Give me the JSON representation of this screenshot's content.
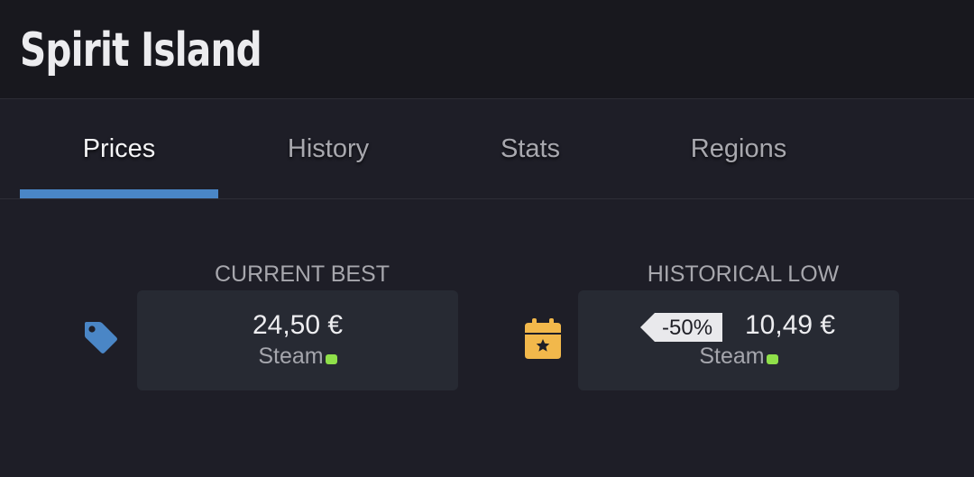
{
  "header": {
    "title": "Spirit Island"
  },
  "tabs": [
    {
      "label": "Prices",
      "active": true
    },
    {
      "label": "History",
      "active": false
    },
    {
      "label": "Stats",
      "active": false
    },
    {
      "label": "Regions",
      "active": false
    }
  ],
  "current_best": {
    "label": "CURRENT BEST",
    "icon": "price-tag-icon",
    "price": "24,50 €",
    "store": "Steam"
  },
  "historical_low": {
    "label": "HISTORICAL LOW",
    "icon": "calendar-star-icon",
    "discount": "-50%",
    "price": "10,49 €",
    "store": "Steam"
  },
  "colors": {
    "accent": "#4a86c6",
    "tag_icon": "#4a86c6",
    "calendar_icon": "#f2b84b",
    "store_active_dot": "#8fe04a"
  }
}
